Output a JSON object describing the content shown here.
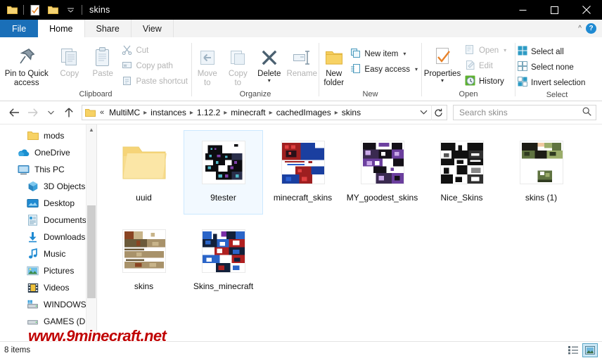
{
  "titlebar": {
    "title": "skins",
    "quick_access": [
      {
        "name": "folder-icon",
        "label": "Properties"
      },
      {
        "name": "properties-icon",
        "label": "Properties"
      },
      {
        "name": "new-folder-icon",
        "label": "New folder"
      },
      {
        "name": "chevron-down-icon",
        "label": "Customize Quick Access Toolbar"
      }
    ],
    "minimize_label": "Minimize",
    "maximize_label": "Maximize",
    "close_label": "Close"
  },
  "tabs": [
    {
      "label": "File",
      "kind": "file"
    },
    {
      "label": "Home",
      "kind": "active"
    },
    {
      "label": "Share",
      "kind": "normal"
    },
    {
      "label": "View",
      "kind": "normal"
    }
  ],
  "ribbon": {
    "help_label": "?",
    "collapse_label": "^",
    "groups": [
      {
        "label": "Clipboard",
        "big": [
          {
            "label": "Pin to Quick access",
            "icon": "pin-icon",
            "dim": false
          },
          {
            "label": "Copy",
            "icon": "copy-icon",
            "dim": true
          },
          {
            "label": "Paste",
            "icon": "paste-icon",
            "dim": true
          }
        ],
        "small": [
          {
            "label": "Cut",
            "icon": "cut-icon",
            "dim": true
          },
          {
            "label": "Copy path",
            "icon": "copy-path-icon",
            "dim": true
          },
          {
            "label": "Paste shortcut",
            "icon": "paste-shortcut-icon",
            "dim": true
          }
        ]
      },
      {
        "label": "Organize",
        "big": [
          {
            "label": "Move to",
            "icon": "move-to-icon",
            "dim": true,
            "caret": true
          },
          {
            "label": "Copy to",
            "icon": "copy-to-icon",
            "dim": true,
            "caret": true
          },
          {
            "label": "Delete",
            "icon": "delete-icon",
            "dim": false,
            "caret": true
          },
          {
            "label": "Rename",
            "icon": "rename-icon",
            "dim": true
          }
        ],
        "small": []
      },
      {
        "label": "New",
        "big": [
          {
            "label": "New folder",
            "icon": "new-folder-icon",
            "dim": false
          }
        ],
        "small": [
          {
            "label": "New item",
            "icon": "new-item-icon",
            "dim": false,
            "caret": true
          },
          {
            "label": "Easy access",
            "icon": "easy-access-icon",
            "dim": false,
            "caret": true
          }
        ]
      },
      {
        "label": "Open",
        "big": [
          {
            "label": "Properties",
            "icon": "properties-icon",
            "dim": false,
            "caret": true
          }
        ],
        "small": [
          {
            "label": "Open",
            "icon": "open-icon",
            "dim": true,
            "caret": true
          },
          {
            "label": "Edit",
            "icon": "edit-icon",
            "dim": true
          },
          {
            "label": "History",
            "icon": "history-icon",
            "dim": false
          }
        ]
      },
      {
        "label": "Select",
        "big": [],
        "small": [
          {
            "label": "Select all",
            "icon": "select-all-icon",
            "dim": false
          },
          {
            "label": "Select none",
            "icon": "select-none-icon",
            "dim": false
          },
          {
            "label": "Invert selection",
            "icon": "invert-selection-icon",
            "dim": false
          }
        ]
      }
    ]
  },
  "addressbar": {
    "back_label": "Back",
    "forward_label": "Forward",
    "recent_label": "Recent locations",
    "up_label": "Up",
    "overflow": "«",
    "crumbs": [
      "MultiMC",
      "instances",
      "1.12.2",
      "minecraft",
      "cachedImages",
      "skins"
    ],
    "dropdown_label": "Previous locations",
    "refresh_label": "Refresh",
    "search_placeholder": "Search skins",
    "search_value": ""
  },
  "navpane": {
    "items": [
      {
        "label": "mods",
        "icon": "folder-icon",
        "level": 1
      },
      {
        "label": "OneDrive",
        "icon": "onedrive-icon",
        "level": 0
      },
      {
        "label": "This PC",
        "icon": "this-pc-icon",
        "level": 0
      },
      {
        "label": "3D Objects",
        "icon": "3d-objects-icon",
        "level": 1
      },
      {
        "label": "Desktop",
        "icon": "desktop-icon",
        "level": 1
      },
      {
        "label": "Documents",
        "icon": "documents-icon",
        "level": 1
      },
      {
        "label": "Downloads",
        "icon": "downloads-icon",
        "level": 1
      },
      {
        "label": "Music",
        "icon": "music-icon",
        "level": 1
      },
      {
        "label": "Pictures",
        "icon": "pictures-icon",
        "level": 1
      },
      {
        "label": "Videos",
        "icon": "videos-icon",
        "level": 1
      },
      {
        "label": "WINDOWS (C:)",
        "icon": "drive-icon",
        "level": 1
      },
      {
        "label": "GAMES (D:)",
        "icon": "drive-icon",
        "level": 1
      }
    ]
  },
  "files": [
    {
      "name": "uuid",
      "type": "folder",
      "selected": false
    },
    {
      "name": "9tester",
      "type": "image",
      "selected": true,
      "palette": [
        "#0c0c10",
        "#2a2f4a",
        "#4fb8c8",
        "#7d3fa8",
        "#ffffff"
      ]
    },
    {
      "name": "minecraft_skins",
      "type": "image",
      "selected": false,
      "palette": [
        "#1a3fa0",
        "#9e1f20",
        "#e04040",
        "#ffffff",
        "#2a5fd0"
      ]
    },
    {
      "name": "MY_goodest_skins",
      "type": "image",
      "selected": false,
      "palette": [
        "#141018",
        "#6b3f9e",
        "#c9a8e8",
        "#3a2a50",
        "#ffffff"
      ]
    },
    {
      "name": "Nice_Skins",
      "type": "image",
      "selected": false,
      "palette": [
        "#111111",
        "#2f2f2f",
        "#ffffff",
        "#555555",
        "#888888"
      ]
    },
    {
      "name": "skins (1)",
      "type": "image",
      "selected": false,
      "palette": [
        "#1c1c14",
        "#5f7340",
        "#9bad6a",
        "#2f3a20",
        "#ffffff"
      ]
    },
    {
      "name": "skins",
      "type": "image",
      "selected": false,
      "palette": [
        "#6b5a3a",
        "#a8926a",
        "#c8b48a",
        "#8a4422",
        "#ffffff"
      ]
    },
    {
      "name": "Skins_minecraft",
      "type": "image",
      "selected": false,
      "palette": [
        "#12203a",
        "#2a64c8",
        "#b02020",
        "#ffffff",
        "#7a2fa8"
      ]
    }
  ],
  "statusbar": {
    "item_count": "8 items",
    "view_details_label": "Details view",
    "view_large_icons_label": "Large icons view"
  },
  "watermark": {
    "text": "www.9minecraft.net",
    "color": "#c00000"
  }
}
